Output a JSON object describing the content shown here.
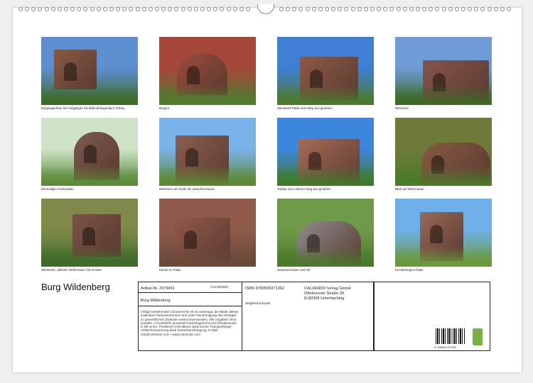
{
  "calendar": {
    "title": "Burg Wildenberg",
    "photos": [
      {
        "caption": "Eingangspforte für Fußgänger mit dahinterliegendem Torbau",
        "sky": "#5d8fd0",
        "wall": "#8a5a44",
        "green": "#3f6b2a"
      },
      {
        "caption": "Burgtor",
        "sky": "#a5483a",
        "wall": "#9e4b3c",
        "green": "#4f7a2e"
      },
      {
        "caption": "Stirnwand Palas vom Weg aus gesehen",
        "sky": "#3f7fd4",
        "wall": "#8d5a49",
        "green": "#4b7a2f"
      },
      {
        "caption": "Wehrturm",
        "sky": "#6f9bd6",
        "wall": "#85544a",
        "green": "#3d6a25"
      },
      {
        "caption": "Ehemaliger Küchenbau",
        "sky": "#cfe3c9",
        "wall": "#7d5a4e",
        "green": "#5b8a38"
      },
      {
        "caption": "Wehrturm am Ende der Zwischenmauer",
        "sky": "#7ab3ea",
        "wall": "#8b5e4e",
        "green": "#5e8a35"
      },
      {
        "caption": "Torbau vom unteren Weg aus gesehen",
        "sky": "#3d86de",
        "wall": "#a56b57",
        "green": "#3f7a2a"
      },
      {
        "caption": "Blick auf Wehrmauer",
        "sky": "#6f7a3a",
        "wall": "#8a5a44",
        "green": "#4c7a2a"
      },
      {
        "caption": "Steinreste, dahinter Wehrmauer mit Fenster",
        "sky": "#7f8a4a",
        "wall": "#7c5446",
        "green": "#3f6a2a"
      },
      {
        "caption": "Kamin im Palas",
        "sky": "#8e5a4a",
        "wall": "#93594a",
        "green": "#6a4a3a"
      },
      {
        "caption": "Zwischenmauer und Tor",
        "sky": "#6f9a4a",
        "wall": "#8d8d8d",
        "green": "#4a7a2a"
      },
      {
        "caption": "Fensterbogen Palas",
        "sky": "#6fb0ea",
        "wall": "#9a6a5a",
        "green": "#6a9a3a"
      }
    ]
  },
  "info": {
    "article_label": "Artikel-Nr. 2379491",
    "publisher_logo": "CALVENDO",
    "product_title": "Burg Wildenberg",
    "legal_text": "Infolge bestehender Schutzrechte ist es untersagt, die Bilder dieses Kalenders herauszutrennen und ohne Genehmigung des Verlages zu gewerblichen Zwecken weiterzuverwenden. Alle Angaben ohne Gewähr. CALVENDO produziert bedarfsgerecht und klimabewusst in DE & EU. Positivere CO2-Bilanz dank kurzer Transportwege. Abfall-Reduzierung dank Einzelstückfertigung. E-Mail: info@calvendo.com • www.calvendo.com",
    "isbn": "ISBN 9783569371392",
    "author": "Siegfried Kreuzer",
    "publisher_name": "CALVENDO Verlag GmbH",
    "publisher_street": "Ottobrunner Straße 39",
    "publisher_city": "D-82008 Unterhaching",
    "barcode_number": "9 783569 371392"
  }
}
